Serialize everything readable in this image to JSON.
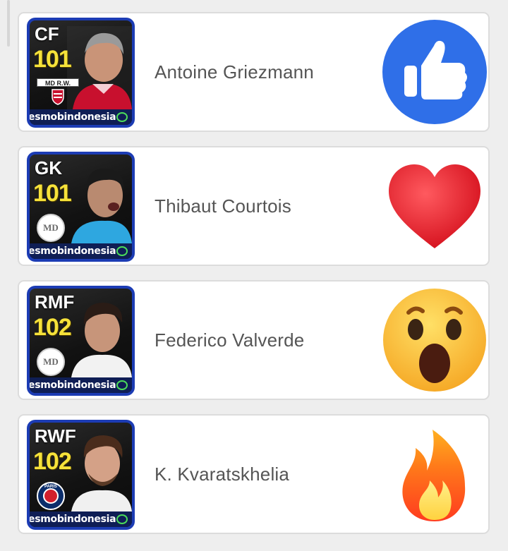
{
  "watermark_text": "esmobindonesia",
  "reaction_colors": {
    "like_blue": "#2f6fe8",
    "heart_red": "#e8121f",
    "wow_yellow": "#ffcc33",
    "fire_orange": "#ff7a1a"
  },
  "players": [
    {
      "position": "CF",
      "rating": "101",
      "name": "Antoine Griezmann",
      "club_text": "MD R.W.",
      "badge": "atletico-crest",
      "reaction": "thumbs-up-icon"
    },
    {
      "position": "GK",
      "rating": "101",
      "name": "Thibaut Courtois",
      "club_text": "MD",
      "badge": "real-madrid-crest",
      "reaction": "heart-icon"
    },
    {
      "position": "RMF",
      "rating": "102",
      "name": "Federico Valverde",
      "club_text": "MD",
      "badge": "real-madrid-crest",
      "reaction": "wow-face-icon"
    },
    {
      "position": "RWF",
      "rating": "102",
      "name": "K. Kvaratskhelia",
      "club_text": "PARIS",
      "badge": "psg-crest",
      "reaction": "fire-icon"
    }
  ]
}
